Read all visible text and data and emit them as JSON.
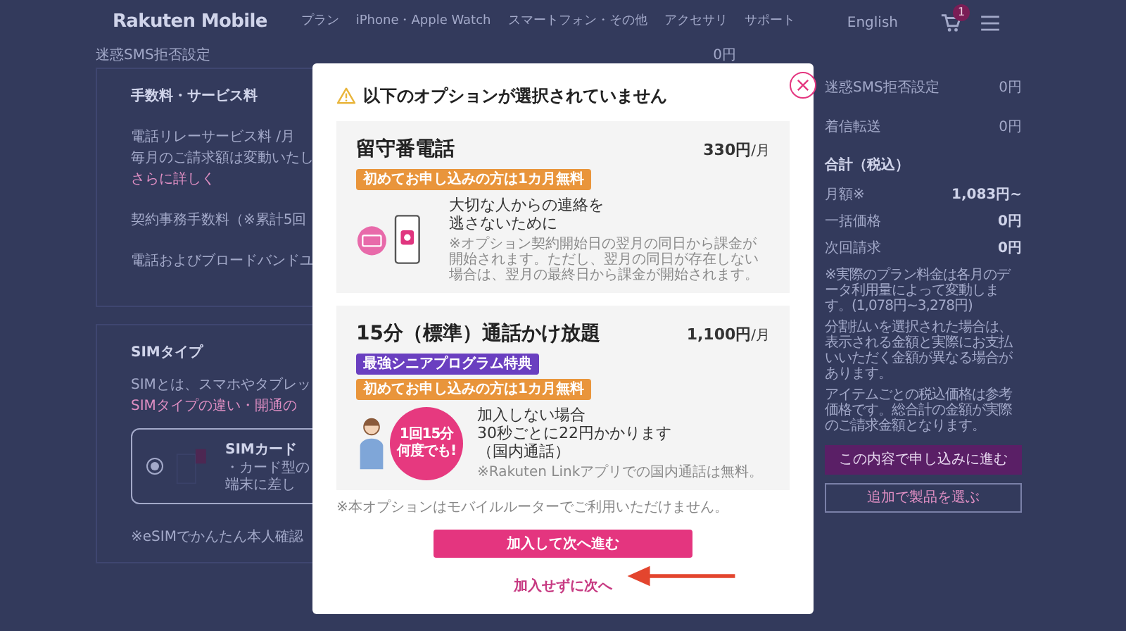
{
  "header": {
    "logo": "Rakuten Mobile",
    "nav": [
      "プラン",
      "iPhone・Apple Watch",
      "スマートフォン・その他",
      "アクセサリ",
      "サポート"
    ],
    "language": "English",
    "cart_count": "1"
  },
  "background": {
    "top_row": {
      "label": "迷惑SMS拒否設定",
      "value": "0円"
    },
    "fees_section": {
      "heading": "手数料・サービス料",
      "items": [
        {
          "label": "電話リレーサービス料 /月",
          "note": "毎月のご請求額は変動いたし",
          "link": "さらに詳しく"
        },
        {
          "label": "契約事務手数料（※累計5回"
        },
        {
          "label": "電話およびブロードバンドユ"
        }
      ]
    },
    "sim_section": {
      "heading": "SIMタイプ",
      "description": "SIMとは、スマホやタブレッ",
      "link": "SIMタイプの違い・開通の",
      "option": {
        "title": "SIMカード",
        "selected": true,
        "lines": [
          "・カード型の",
          "端末に差し"
        ]
      },
      "footnote": "※eSIMでかんたん本人確認"
    },
    "summary": {
      "rows": [
        {
          "label": "迷惑SMS拒否設定",
          "value": "0円"
        },
        {
          "label": "着信転送",
          "value": "0円"
        }
      ],
      "total_heading": "合計（税込）",
      "totals": [
        {
          "label": "月額※",
          "value": "1,083円~"
        },
        {
          "label": "一括価格",
          "value": "0円"
        },
        {
          "label": "次回請求",
          "value": "0円"
        }
      ],
      "notes": [
        "※実際のプラン料金は各月のデータ利用量によって変動します。(1,078円~3,278円)",
        "分割払いを選択された場合は、表示される金額と実際にお支払いいただく金額が異なる場合があります。",
        "アイテムごとの税込価格は参考価格です。総合計の金額が実際のご請求金額となります。"
      ],
      "primary_button": "この内容で申し込みに進む",
      "secondary_button": "追加で製品を選ぶ"
    }
  },
  "modal": {
    "title": "以下のオプションが選択されていません",
    "options": [
      {
        "kind": "voicemail",
        "title": "留守番電話",
        "price": "330円",
        "unit": "/月",
        "badges": [
          {
            "text": "初めてお申し込みの方は1カ月無料",
            "color": "#e9953b"
          }
        ],
        "description": [
          "大切な人からの連絡を",
          "逃さないために"
        ],
        "note": "※オプション契約開始日の翌月の同日から課金が開始されます。ただし、翌月の同日が存在しない場合は、翌月の最終日から課金が開始されます。"
      },
      {
        "kind": "calling",
        "title": "15分（標準）通話かけ放題",
        "price": "1,100円",
        "unit": "/月",
        "badges": [
          {
            "text": "最強シニアプログラム特典",
            "color": "#6a3fc0"
          },
          {
            "text": "初めてお申し込みの方は1カ月無料",
            "color": "#e9953b"
          }
        ],
        "sticker": [
          "1回15分",
          "何度でも!"
        ],
        "description": [
          "加入しない場合",
          "30秒ごとに22円かかります",
          "（国内通話）"
        ],
        "note": "※Rakuten Linkアプリでの国内通話は無料。"
      }
    ],
    "footnote": "※本オプションはモバイルルーターでご利用いただけません。",
    "primary_button": "加入して次へ進む",
    "skip_link": "加入せずに次へ"
  }
}
